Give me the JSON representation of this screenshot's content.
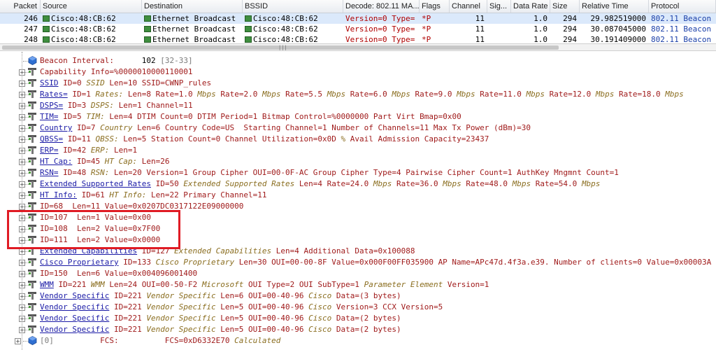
{
  "columns": [
    "Packet",
    "Source",
    "Destination",
    "BSSID",
    "Decode: 802.11 MA...",
    "Flags",
    "Channel",
    "Sig...",
    "Data Rate",
    "Size",
    "Relative Time",
    "Protocol"
  ],
  "packets": [
    {
      "packet": "246",
      "source": "Cisco:48:CB:62",
      "destination": "Ethernet Broadcast",
      "bssid": "Cisco:48:CB:62",
      "decode": "Version=0  Type=",
      "flags": "*P",
      "channel": "11",
      "signal": "",
      "data_rate": "1.0",
      "size": "294",
      "time": "29.982519000",
      "protocol": "802.11 Beacon"
    },
    {
      "packet": "247",
      "source": "Cisco:48:CB:62",
      "destination": "Ethernet Broadcast",
      "bssid": "Cisco:48:CB:62",
      "decode": "Version=0  Type=",
      "flags": "*P",
      "channel": "11",
      "signal": "",
      "data_rate": "1.0",
      "size": "294",
      "time": "30.087045000",
      "protocol": "802.11 Beacon"
    },
    {
      "packet": "248",
      "source": "Cisco:48:CB:62",
      "destination": "Ethernet Broadcast",
      "bssid": "Cisco:48:CB:62",
      "decode": "Version=0  Type=",
      "flags": "*P",
      "channel": "11",
      "signal": "",
      "data_rate": "1.0",
      "size": "294",
      "time": "30.191409000",
      "protocol": "802.11 Beacon"
    }
  ],
  "tree": [
    {
      "name": "beacon-interval",
      "icon": "field",
      "segs": [
        [
          "nm",
          "Beacon Interval:      "
        ],
        [
          "dk",
          "102 "
        ],
        [
          "gr",
          "[32-33]"
        ]
      ]
    },
    {
      "name": "capability-info",
      "icon": "tag",
      "segs": [
        [
          "nm",
          "Capability Info=%0000010000110001"
        ]
      ]
    },
    {
      "name": "ssid",
      "icon": "tag",
      "segs": [
        [
          "lk",
          "SSID"
        ],
        [
          "nm",
          " ID=0 "
        ],
        [
          "it",
          "SSID"
        ],
        [
          "nm",
          " Len=10 SSID=CWNP_rules"
        ]
      ]
    },
    {
      "name": "rates",
      "icon": "tag",
      "segs": [
        [
          "lk",
          "Rates="
        ],
        [
          "nm",
          " ID=1 "
        ],
        [
          "it",
          "Rates:"
        ],
        [
          "nm",
          " Len=8 Rate=1.0 "
        ],
        [
          "it",
          "Mbps"
        ],
        [
          "nm",
          " Rate=2.0 "
        ],
        [
          "it",
          "Mbps"
        ],
        [
          "nm",
          " Rate=5.5 "
        ],
        [
          "it",
          "Mbps"
        ],
        [
          "nm",
          " Rate=6.0 "
        ],
        [
          "it",
          "Mbps"
        ],
        [
          "nm",
          " Rate=9.0 "
        ],
        [
          "it",
          "Mbps"
        ],
        [
          "nm",
          " Rate=11.0 "
        ],
        [
          "it",
          "Mbps"
        ],
        [
          "nm",
          " Rate=12.0 "
        ],
        [
          "it",
          "Mbps"
        ],
        [
          "nm",
          " Rate=18.0 "
        ],
        [
          "it",
          "Mbps"
        ]
      ]
    },
    {
      "name": "dsps",
      "icon": "tag",
      "segs": [
        [
          "lk",
          "DSPS="
        ],
        [
          "nm",
          " ID=3 "
        ],
        [
          "it",
          "DSPS:"
        ],
        [
          "nm",
          " Len=1 Channel=11"
        ]
      ]
    },
    {
      "name": "tim",
      "icon": "tag",
      "segs": [
        [
          "lk",
          "TIM="
        ],
        [
          "nm",
          " ID=5 "
        ],
        [
          "it",
          "TIM:"
        ],
        [
          "nm",
          " Len=4 DTIM Count=0 DTIM Period=1 Bitmap Control=%0000000 Part Virt Bmap=0x00"
        ]
      ]
    },
    {
      "name": "country",
      "icon": "tag",
      "segs": [
        [
          "lk",
          "Country"
        ],
        [
          "nm",
          " ID=7 "
        ],
        [
          "it",
          "Country"
        ],
        [
          "nm",
          " Len=6 Country Code=US  Starting Channel=1 Number of Channels=11 Max Tx Power (dBm)=30"
        ]
      ]
    },
    {
      "name": "qbss",
      "icon": "tag",
      "segs": [
        [
          "lk",
          "QBSS="
        ],
        [
          "nm",
          " ID=11 "
        ],
        [
          "it",
          "QBSS:"
        ],
        [
          "nm",
          " Len=5 Station Count=0 Channel Utilization=0x0D "
        ],
        [
          "it",
          "%"
        ],
        [
          "nm",
          " Avail Admission Capacity=23437"
        ]
      ]
    },
    {
      "name": "erp",
      "icon": "tag",
      "segs": [
        [
          "lk",
          "ERP="
        ],
        [
          "nm",
          " ID=42 "
        ],
        [
          "it",
          "ERP:"
        ],
        [
          "nm",
          " Len=1"
        ]
      ]
    },
    {
      "name": "ht-cap",
      "icon": "tag",
      "segs": [
        [
          "lk",
          "HT Cap:"
        ],
        [
          "nm",
          " ID=45 "
        ],
        [
          "it",
          "HT Cap:"
        ],
        [
          "nm",
          " Len=26"
        ]
      ]
    },
    {
      "name": "rsn",
      "icon": "tag",
      "segs": [
        [
          "lk",
          "RSN="
        ],
        [
          "nm",
          " ID=48 "
        ],
        [
          "it",
          "RSN:"
        ],
        [
          "nm",
          " Len=20 Version=1 Group Cipher OUI=00-0F-AC Group Cipher Type=4 Pairwise Cipher Count=1 AuthKey Mngmnt Count=1"
        ]
      ]
    },
    {
      "name": "extended-supported-rates",
      "icon": "tag",
      "segs": [
        [
          "lk",
          "Extended Supported Rates"
        ],
        [
          "nm",
          " ID=50 "
        ],
        [
          "it",
          "Extended Supported Rates"
        ],
        [
          "nm",
          " Len=4 Rate=24.0 "
        ],
        [
          "it",
          "Mbps"
        ],
        [
          "nm",
          " Rate=36.0 "
        ],
        [
          "it",
          "Mbps"
        ],
        [
          "nm",
          " Rate=48.0 "
        ],
        [
          "it",
          "Mbps"
        ],
        [
          "nm",
          " Rate=54.0 "
        ],
        [
          "it",
          "Mbps"
        ]
      ]
    },
    {
      "name": "ht-info",
      "icon": "tag",
      "segs": [
        [
          "lk",
          "HT Info:"
        ],
        [
          "nm",
          " ID=61 "
        ],
        [
          "it",
          "HT Info:"
        ],
        [
          "nm",
          " Len=22 Primary Channel=11"
        ]
      ]
    },
    {
      "name": "element-68",
      "icon": "tag",
      "segs": [
        [
          "nm",
          "ID=68  Len=11 Value=0x0207DC0317122E09000000"
        ]
      ]
    },
    {
      "name": "element-107",
      "icon": "tag",
      "segs": [
        [
          "nm",
          "ID=107  Len=1 Value=0x00"
        ]
      ]
    },
    {
      "name": "element-108",
      "icon": "tag",
      "segs": [
        [
          "nm",
          "ID=108  Len=2 Value=0x7F00"
        ]
      ]
    },
    {
      "name": "element-111",
      "icon": "tag",
      "segs": [
        [
          "nm",
          "ID=111  Len=2 Value=0x0000"
        ]
      ]
    },
    {
      "name": "extended-capabilities",
      "icon": "tag",
      "segs": [
        [
          "lk",
          "Extended Capabilities"
        ],
        [
          "nm",
          " ID=127 "
        ],
        [
          "it",
          "Extended Capabilities"
        ],
        [
          "nm",
          " Len=4 Additional Data=0x100088"
        ]
      ]
    },
    {
      "name": "cisco-proprietary",
      "icon": "tag",
      "segs": [
        [
          "lk",
          "Cisco Proprietary"
        ],
        [
          "nm",
          " ID=133 "
        ],
        [
          "it",
          "Cisco Proprietary"
        ],
        [
          "nm",
          " Len=30 OUI=00-00-8F Value=0x000F00FF035900 AP Name=APc47d.4f3a.e39. Number of clients=0 Value=0x00003A"
        ]
      ]
    },
    {
      "name": "element-150",
      "icon": "tag",
      "segs": [
        [
          "nm",
          "ID=150  Len=6 Value=0x004096001400"
        ]
      ]
    },
    {
      "name": "wmm",
      "icon": "tag",
      "segs": [
        [
          "lk",
          "WMM"
        ],
        [
          "nm",
          " ID=221 "
        ],
        [
          "it",
          "WMM"
        ],
        [
          "nm",
          " Len=24 OUI=00-50-F2 "
        ],
        [
          "it",
          "Microsoft"
        ],
        [
          "nm",
          " OUI Type=2 OUI SubType=1 "
        ],
        [
          "it",
          "Parameter Element"
        ],
        [
          "nm",
          " Version=1"
        ]
      ]
    },
    {
      "name": "vendor-specific-1",
      "icon": "tag",
      "segs": [
        [
          "lk",
          "Vendor Specific"
        ],
        [
          "nm",
          " ID=221 "
        ],
        [
          "it",
          "Vendor Specific"
        ],
        [
          "nm",
          " Len=6 OUI=00-40-96 "
        ],
        [
          "it",
          "Cisco"
        ],
        [
          "nm",
          " Data=(3 bytes)"
        ]
      ]
    },
    {
      "name": "vendor-specific-2",
      "icon": "tag",
      "segs": [
        [
          "lk",
          "Vendor Specific"
        ],
        [
          "nm",
          " ID=221 "
        ],
        [
          "it",
          "Vendor Specific"
        ],
        [
          "nm",
          " Len=5 OUI=00-40-96 "
        ],
        [
          "it",
          "Cisco"
        ],
        [
          "nm",
          " Version=3 CCX Version=5"
        ]
      ]
    },
    {
      "name": "vendor-specific-3",
      "icon": "tag",
      "segs": [
        [
          "lk",
          "Vendor Specific"
        ],
        [
          "nm",
          " ID=221 "
        ],
        [
          "it",
          "Vendor Specific"
        ],
        [
          "nm",
          " Len=5 OUI=00-40-96 "
        ],
        [
          "it",
          "Cisco"
        ],
        [
          "nm",
          " Data=(2 bytes)"
        ]
      ]
    },
    {
      "name": "vendor-specific-4",
      "icon": "tag",
      "segs": [
        [
          "lk",
          "Vendor Specific"
        ],
        [
          "nm",
          " ID=221 "
        ],
        [
          "it",
          "Vendor Specific"
        ],
        [
          "nm",
          " Len=5 OUI=00-40-96 "
        ],
        [
          "it",
          "Cisco"
        ],
        [
          "nm",
          " Data=(2 bytes)"
        ]
      ]
    },
    {
      "name": "fcs",
      "icon": "field",
      "segs": [
        [
          "gr",
          "[0]          "
        ],
        [
          "nm",
          "FCS:          FCS=0xD6332E70 "
        ],
        [
          "it",
          "Calculated"
        ]
      ]
    }
  ],
  "scroll_marker": "|||",
  "colors": {
    "accent_red": "#e01b24",
    "header_bg": "#e9ecf1",
    "selected_row": "#dbe9fb",
    "text_red": "#a01b1b",
    "link_blue": "#1a1aa6"
  }
}
